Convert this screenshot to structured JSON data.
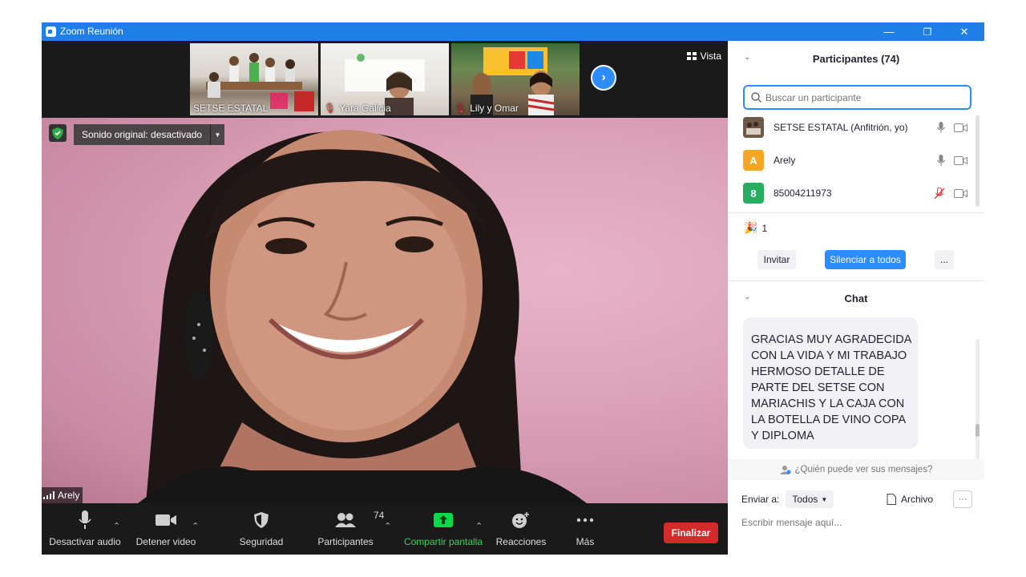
{
  "window": {
    "title": "Zoom Reunión",
    "controls": {
      "minimize": "—",
      "restore": "❐",
      "close": "✕"
    }
  },
  "thumbnails": [
    {
      "name": "SETSE ESTATAL",
      "muted": false
    },
    {
      "name": "Yara Galicia",
      "muted": true
    },
    {
      "name": "Lily y Omar",
      "muted": true
    }
  ],
  "view_label": "Vista",
  "main_video": {
    "sound_label": "Sonido original: desactivado",
    "speaker_name": "Arely"
  },
  "toolbar": {
    "mute_label": "Desactivar audio",
    "video_label": "Detener video",
    "security_label": "Seguridad",
    "participants_label": "Participantes",
    "participants_count": "74",
    "share_label": "Compartir pantalla",
    "reactions_label": "Reacciones",
    "more_label": "Más",
    "end_label": "Finalizar"
  },
  "participants_panel": {
    "title": "Participantes (74)",
    "search_placeholder": "Buscar un participante",
    "list": [
      {
        "name": "SETSE ESTATAL (Anfitrión, yo)",
        "avatar": "",
        "avatar_color": "#5b4a3a",
        "mic_muted": false
      },
      {
        "name": "Arely",
        "avatar": "A",
        "avatar_color": "#f5a623",
        "mic_muted": false
      },
      {
        "name": "85004211973",
        "avatar": "8",
        "avatar_color": "#27ae60",
        "mic_muted": true
      }
    ],
    "reaction_count": "1",
    "invite_label": "Invitar",
    "mute_all_label": "Silenciar a todos",
    "more_label": "..."
  },
  "chat_panel": {
    "title": "Chat",
    "message": "GRACIAS MUY AGRADECIDA CON LA VIDA Y MI TRABAJO HERMOSO DETALLE DE PARTE DEL SETSE CON MARIACHIS Y LA CAJA CON LA BOTELLA DE VINO COPA Y DIPLOMA",
    "who_sees": "¿Quién puede ver sus mensajes?",
    "send_to_label": "Enviar a:",
    "send_to_value": "Todos",
    "file_label": "Archivo",
    "more_label": "···",
    "input_placeholder": "Escribir mensaje aquí..."
  },
  "colors": {
    "accent": "#2d8cff",
    "titlebar": "#1f7fe8",
    "end_button": "#d12b2b",
    "share_green": "#0bd94c"
  }
}
